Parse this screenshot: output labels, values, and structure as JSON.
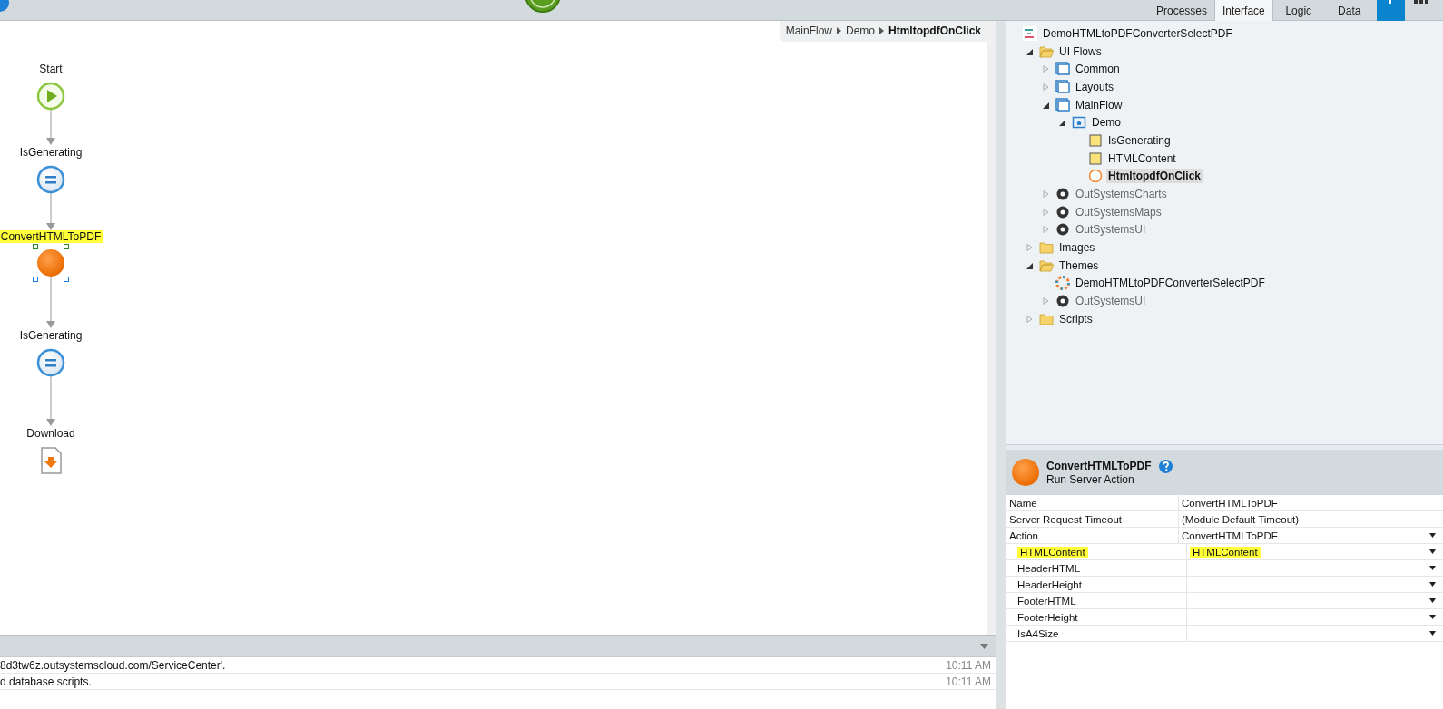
{
  "toolbar": {
    "tabs": [
      {
        "label": "Processes",
        "selected": false
      },
      {
        "label": "Interface",
        "selected": true
      },
      {
        "label": "Logic",
        "selected": false
      },
      {
        "label": "Data",
        "selected": false
      }
    ]
  },
  "breadcrumb": [
    {
      "label": "MainFlow",
      "current": false
    },
    {
      "label": "Demo",
      "current": false
    },
    {
      "label": "HtmltopdfOnClick",
      "current": true
    }
  ],
  "flow_nodes": [
    {
      "kind": "start",
      "label": "Start",
      "selected": false,
      "highlighted": false
    },
    {
      "kind": "assign",
      "label": "IsGenerating",
      "selected": false,
      "highlighted": false
    },
    {
      "kind": "server-action",
      "label": "ConvertHTMLToPDF",
      "selected": true,
      "highlighted": true
    },
    {
      "kind": "assign",
      "label": "IsGenerating",
      "selected": false,
      "highlighted": false
    },
    {
      "kind": "download",
      "label": "Download",
      "selected": false,
      "highlighted": false
    }
  ],
  "output_log": [
    {
      "message": "8d3tw6z.outsystemscloud.com/ServiceCenter'.",
      "time": "10:11 AM"
    },
    {
      "message": "d database scripts.",
      "time": "10:11 AM"
    }
  ],
  "tree": {
    "label": "DemoHTMLtoPDFConverterSelectPDF",
    "kind": "module",
    "selected": false,
    "children": [
      {
        "label": "UI Flows",
        "kind": "folder",
        "expanded": true,
        "selected": false,
        "children": [
          {
            "label": "Common",
            "kind": "flow",
            "expanded": false,
            "selected": false
          },
          {
            "label": "Layouts",
            "kind": "flow",
            "expanded": false,
            "selected": false
          },
          {
            "label": "MainFlow",
            "kind": "flow",
            "expanded": true,
            "selected": false,
            "children": [
              {
                "label": "Demo",
                "kind": "screen",
                "expanded": true,
                "selected": false,
                "children": [
                  {
                    "label": "IsGenerating",
                    "kind": "variable",
                    "selected": false
                  },
                  {
                    "label": "HTMLContent",
                    "kind": "variable",
                    "selected": false
                  },
                  {
                    "label": "HtmltopdfOnClick",
                    "kind": "action",
                    "selected": true
                  }
                ]
              }
            ]
          },
          {
            "label": "OutSystemsCharts",
            "kind": "reference",
            "expanded": false,
            "selected": false
          },
          {
            "label": "OutSystemsMaps",
            "kind": "reference",
            "expanded": false,
            "selected": false
          },
          {
            "label": "OutSystemsUI",
            "kind": "reference",
            "expanded": false,
            "selected": false
          }
        ]
      },
      {
        "label": "Images",
        "kind": "folder",
        "expanded": false,
        "selected": false
      },
      {
        "label": "Themes",
        "kind": "folder",
        "expanded": true,
        "selected": false,
        "children": [
          {
            "label": "DemoHTMLtoPDFConverterSelectPDF",
            "kind": "theme",
            "selected": false
          },
          {
            "label": "OutSystemsUI",
            "kind": "reference",
            "expanded": false,
            "selected": false
          }
        ]
      },
      {
        "label": "Scripts",
        "kind": "folder",
        "expanded": false,
        "selected": false
      }
    ]
  },
  "properties": {
    "title": "ConvertHTMLToPDF",
    "subtitle": "Run Server Action",
    "rows": [
      {
        "name": "Name",
        "value": "ConvertHTMLToPDF",
        "kind": "text",
        "highlighted": false
      },
      {
        "name": "Server Request Timeout",
        "value": "(Module Default Timeout)",
        "kind": "text",
        "highlighted": false
      },
      {
        "name": "Action",
        "value": "ConvertHTMLToPDF",
        "kind": "dropdown",
        "highlighted": false,
        "children": [
          {
            "name": "HTMLContent",
            "value": "HTMLContent",
            "kind": "dropdown",
            "highlighted": true
          },
          {
            "name": "HeaderHTML",
            "kind": "dropdown",
            "highlighted": false
          },
          {
            "name": "HeaderHeight",
            "kind": "dropdown",
            "highlighted": false
          },
          {
            "name": "FooterHTML",
            "kind": "dropdown",
            "highlighted": false
          },
          {
            "name": "FooterHeight",
            "kind": "dropdown",
            "highlighted": false
          },
          {
            "name": "IsA4Size",
            "kind": "dropdown",
            "highlighted": false
          }
        ]
      }
    ]
  }
}
